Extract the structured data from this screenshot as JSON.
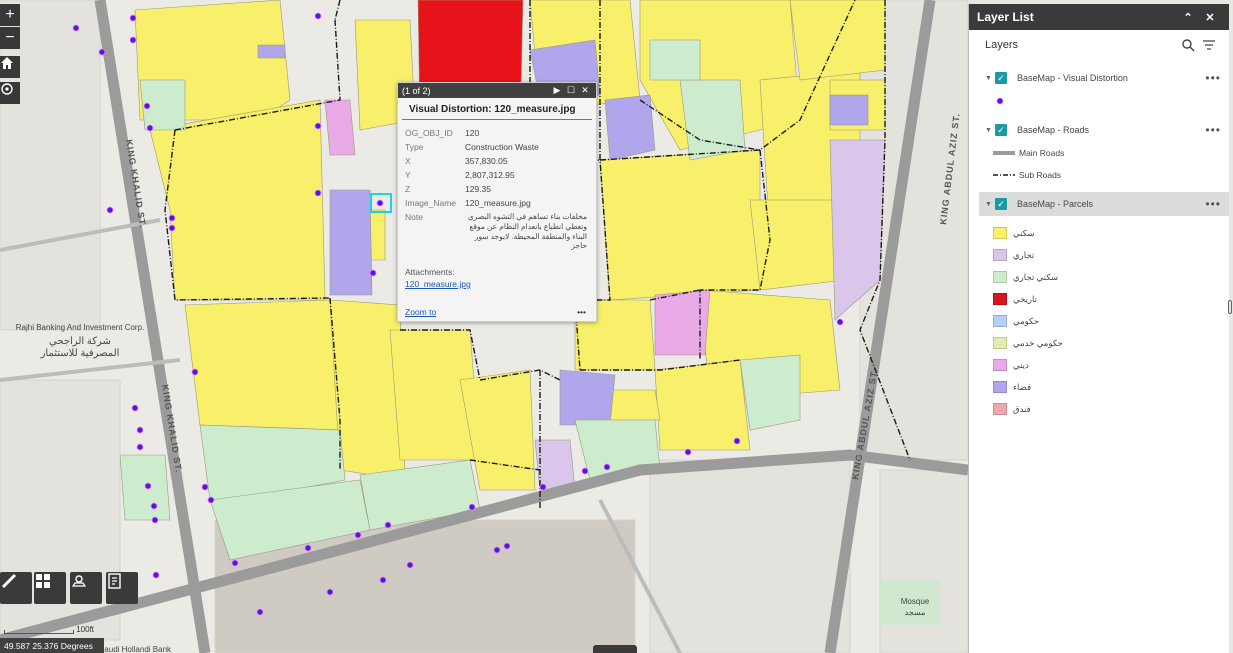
{
  "map": {
    "street_labels": [
      {
        "text": "KING KHALID ST."
      },
      {
        "text": "KING KHALID ST."
      },
      {
        "text": "KING ABDUL AZIZ ST."
      },
      {
        "text": "KING ABDUL AZIZ ST."
      }
    ],
    "poi_labels": {
      "bank_en": "Rajhi Banking And Investment Corp.",
      "bank_ar1": "شركة الراجحي",
      "bank_ar2": "المصرفية للاستثمار",
      "mosque_en": "Mosque",
      "mosque_ar": "مسجد",
      "bottom_left": "Saudi Hollandi Bank"
    },
    "coordinates": "49.587 25.376 Degrees",
    "scale_label": "100ft",
    "colors": {
      "residential": "#f8f06a",
      "commercial": "#d9c6ea",
      "mixed": "#cdeccd",
      "heritage": "#e8121a",
      "government": "#b4d0f4",
      "gov_service": "#e2efb0",
      "religious": "#eaaae8",
      "vacant": "#b0a6ec",
      "hotel": "#f0a6b0",
      "point": "#4a1ce0"
    }
  },
  "controls": {
    "zoom_in": "+",
    "zoom_out": "−",
    "home_icon": "home-icon",
    "locate_icon": "locate-icon"
  },
  "popup": {
    "counter": "(1 of 2)",
    "title": "Visual Distortion: 120_measure.jpg",
    "fields": [
      {
        "key": "OG_OBJ_ID",
        "value": "120"
      },
      {
        "key": "Type",
        "value": "Construction Waste"
      },
      {
        "key": "X",
        "value": "357,830.05"
      },
      {
        "key": "Y",
        "value": "2,807,312.95"
      },
      {
        "key": "Z",
        "value": "129.35"
      },
      {
        "key": "Image_Name",
        "value": "120_measure.jpg"
      }
    ],
    "note_key": "Note",
    "note_value": "مخلفات بناء تساهم في التشوه البصري وتعطي انطباع بانعدام النظام عن موقع البناء والمنطقة المحيطة. لايوجد سور حاجز",
    "attachments_label": "Attachments:",
    "attachment_file": "120_measure.jpg",
    "zoom_to": "Zoom to",
    "more": "•••"
  },
  "layer_list": {
    "title": "Layer List",
    "subtitle": "Layers",
    "layers": [
      {
        "name": "BaseMap - Visual Distortion"
      },
      {
        "name": "BaseMap - Roads"
      },
      {
        "name": "BaseMap - Parcels"
      }
    ],
    "roads_legend": [
      {
        "label": "Main Roads"
      },
      {
        "label": "Sub Roads"
      }
    ],
    "parcel_legend": [
      {
        "label": "سكني",
        "color": "#f8f06a"
      },
      {
        "label": "تجاري",
        "color": "#d9c6ea"
      },
      {
        "label": "سكني تجاري",
        "color": "#cdeccd"
      },
      {
        "label": "تاريخي",
        "color": "#d8141c"
      },
      {
        "label": "حكومي",
        "color": "#b4d0f4"
      },
      {
        "label": "حكومي خدمي",
        "color": "#e2efb0"
      },
      {
        "label": "ديني",
        "color": "#eaaae8"
      },
      {
        "label": "فضاء",
        "color": "#b0a6ec"
      },
      {
        "label": "فندق",
        "color": "#f0a6b0"
      }
    ]
  }
}
